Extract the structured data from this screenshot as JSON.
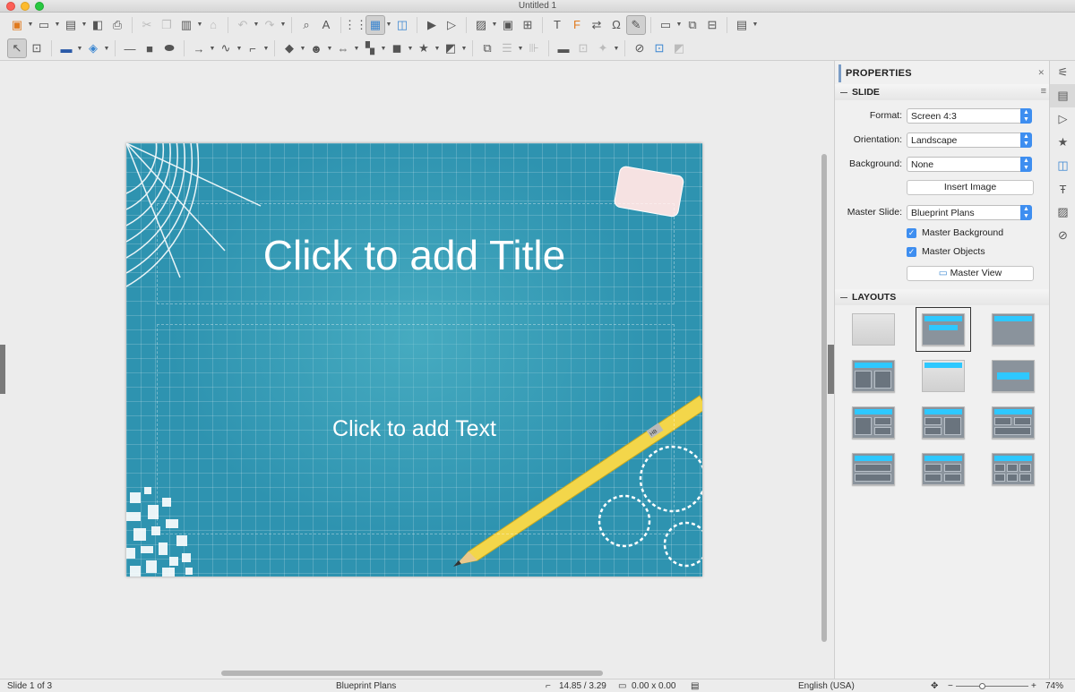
{
  "window": {
    "title": "Untitled 1"
  },
  "slide": {
    "title_placeholder": "Click to add Title",
    "text_placeholder": "Click to add Text",
    "pencil_label": "HB"
  },
  "sidebar": {
    "header": "PROPERTIES",
    "slide_section": "SLIDE",
    "format_label": "Format:",
    "format_value": "Screen 4:3",
    "orientation_label": "Orientation:",
    "orientation_value": "Landscape",
    "background_label": "Background:",
    "background_value": "None",
    "insert_image": "Insert Image",
    "master_slide_label": "Master Slide:",
    "master_slide_value": "Blueprint Plans",
    "master_background": "Master Background",
    "master_objects": "Master Objects",
    "master_view": "Master View",
    "layouts_section": "LAYOUTS"
  },
  "status": {
    "slide_info": "Slide 1 of 3",
    "master_name": "Blueprint Plans",
    "position": "14.85 / 3.29",
    "size": "0.00 x 0.00",
    "language": "English (USA)",
    "zoom": "74%"
  },
  "icons": {
    "toolbar1": [
      "presentation-icon",
      "open-icon",
      "save-icon",
      "export-pdf-icon",
      "print-icon",
      "cut-icon",
      "copy-icon",
      "paste-icon",
      "clone-format-icon",
      "undo-icon",
      "redo-icon",
      "find-icon",
      "spelling-icon",
      "grid-icon",
      "slide-layout-icon",
      "master-slide-icon",
      "start-presentation-icon",
      "image-icon",
      "media-icon",
      "table-icon",
      "textbox-icon",
      "fontwork-icon",
      "special-character-icon",
      "draw-icon",
      "comment-icon",
      "display-views-icon"
    ],
    "toolbar2": [
      "select-icon",
      "zoom-icon",
      "line-color-icon",
      "fill-color-icon",
      "line-icon",
      "rectangle-icon",
      "ellipse-icon",
      "arrow-icon",
      "curve-icon",
      "connector-icon",
      "basic-shapes-icon",
      "symbol-shapes-icon",
      "block-arrows-icon",
      "flowchart-icon",
      "callouts-icon",
      "stars-icon",
      "3d-objects-icon"
    ]
  }
}
